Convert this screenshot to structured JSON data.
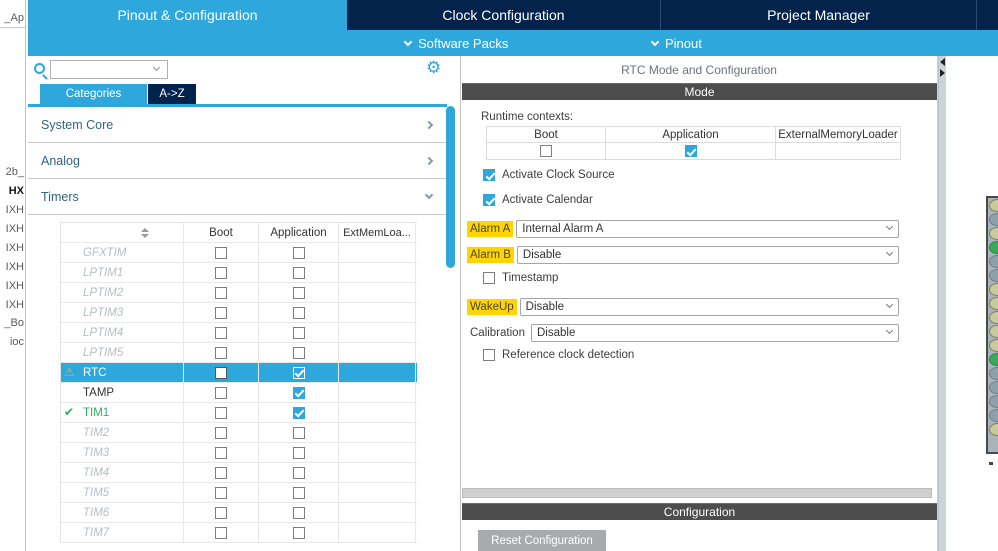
{
  "colors": {
    "accent_blue": "#2ea8dc",
    "navy": "#03234b",
    "section_bar_gray": "#4d4d4d",
    "highlight_yellow": "#ffd400",
    "enabled_green": "#2eae60",
    "warning_yellow": "#f2b200",
    "button_gray": "#a8abad"
  },
  "explorer": {
    "fragments": [
      {
        "label": "_Ap",
        "bold": false
      },
      {
        "label": "2b_",
        "bold": false
      },
      {
        "label": "HX",
        "bold": true
      },
      {
        "label": "IXH",
        "bold": false
      },
      {
        "label": "IXH",
        "bold": false
      },
      {
        "label": "IXH",
        "bold": false
      },
      {
        "label": "IXH",
        "bold": false
      },
      {
        "label": "IXH",
        "bold": false
      },
      {
        "label": "IXH",
        "bold": false
      },
      {
        "label": "_Bo",
        "bold": false
      },
      {
        "label": "ioc",
        "bold": false
      }
    ]
  },
  "top_tabs": [
    {
      "label": "Pinout & Configuration",
      "active": true
    },
    {
      "label": "Clock Configuration",
      "active": false
    },
    {
      "label": "Project Manager",
      "active": false
    }
  ],
  "subnav": {
    "software_packs": "Software Packs",
    "pinout": "Pinout"
  },
  "sidebar": {
    "search_value": "",
    "tabs": [
      {
        "label": "Categories",
        "active": true
      },
      {
        "label": "A->Z",
        "active": false
      }
    ],
    "categories": [
      {
        "label": "System Core",
        "expanded": false
      },
      {
        "label": "Analog",
        "expanded": false
      },
      {
        "label": "Timers",
        "expanded": true
      }
    ],
    "table": {
      "headers": {
        "boot": "Boot",
        "application": "Application",
        "extmem": "ExtMemLoa..."
      },
      "rows": [
        {
          "name": "GFXTIM",
          "style": "inactive",
          "boot": false,
          "app": false
        },
        {
          "name": "LPTIM1",
          "style": "inactive",
          "boot": false,
          "app": false
        },
        {
          "name": "LPTIM2",
          "style": "inactive",
          "boot": false,
          "app": false
        },
        {
          "name": "LPTIM3",
          "style": "inactive",
          "boot": false,
          "app": false
        },
        {
          "name": "LPTIM4",
          "style": "inactive",
          "boot": false,
          "app": false
        },
        {
          "name": "LPTIM5",
          "style": "inactive",
          "boot": false,
          "app": false
        },
        {
          "name": "RTC",
          "style": "selected",
          "icon": "warning",
          "boot": false,
          "app": true
        },
        {
          "name": "TAMP",
          "style": "normal",
          "boot": false,
          "app": true
        },
        {
          "name": "TIM1",
          "style": "enabled",
          "icon": "check",
          "boot": false,
          "app": true
        },
        {
          "name": "TIM2",
          "style": "inactive",
          "boot": false,
          "app": false
        },
        {
          "name": "TIM3",
          "style": "inactive",
          "boot": false,
          "app": false
        },
        {
          "name": "TIM4",
          "style": "inactive",
          "boot": false,
          "app": false
        },
        {
          "name": "TIM5",
          "style": "inactive",
          "boot": false,
          "app": false
        },
        {
          "name": "TIM6",
          "style": "inactive",
          "boot": false,
          "app": false
        },
        {
          "name": "TIM7",
          "style": "inactive",
          "boot": false,
          "app": false
        }
      ]
    }
  },
  "main": {
    "title": "RTC Mode and Configuration",
    "mode_header": "Mode",
    "runtime": {
      "label": "Runtime contexts:",
      "columns": [
        "Boot",
        "Application",
        "ExternalMemoryLoader"
      ],
      "boot_checked": false,
      "application_checked": true
    },
    "activate_clock_source": {
      "label": "Activate Clock Source",
      "checked": true
    },
    "activate_calendar": {
      "label": "Activate Calendar",
      "checked": true
    },
    "alarm_a": {
      "label": "Alarm A",
      "value": "Internal Alarm A",
      "highlight": true
    },
    "alarm_b": {
      "label": "Alarm B",
      "value": "Disable",
      "highlight": true
    },
    "timestamp": {
      "label": "Timestamp",
      "checked": false
    },
    "wakeup": {
      "label": "WakeUp",
      "value": "Disable",
      "highlight": true
    },
    "calibration": {
      "label": "Calibration",
      "value": "Disable",
      "highlight": false
    },
    "ref_clock": {
      "label": "Reference clock detection",
      "checked": false
    },
    "config_header": "Configuration",
    "reset_button": "Reset Configuration"
  },
  "chip": {
    "pins": [
      "khaki",
      "bluegray",
      "khaki",
      "green",
      "bluegray",
      "bluegray",
      "khaki",
      "khaki",
      "khaki",
      "khaki",
      "khaki",
      "green",
      "bluegray",
      "bluegray",
      "bluegray",
      "bluegray",
      "khaki"
    ]
  }
}
